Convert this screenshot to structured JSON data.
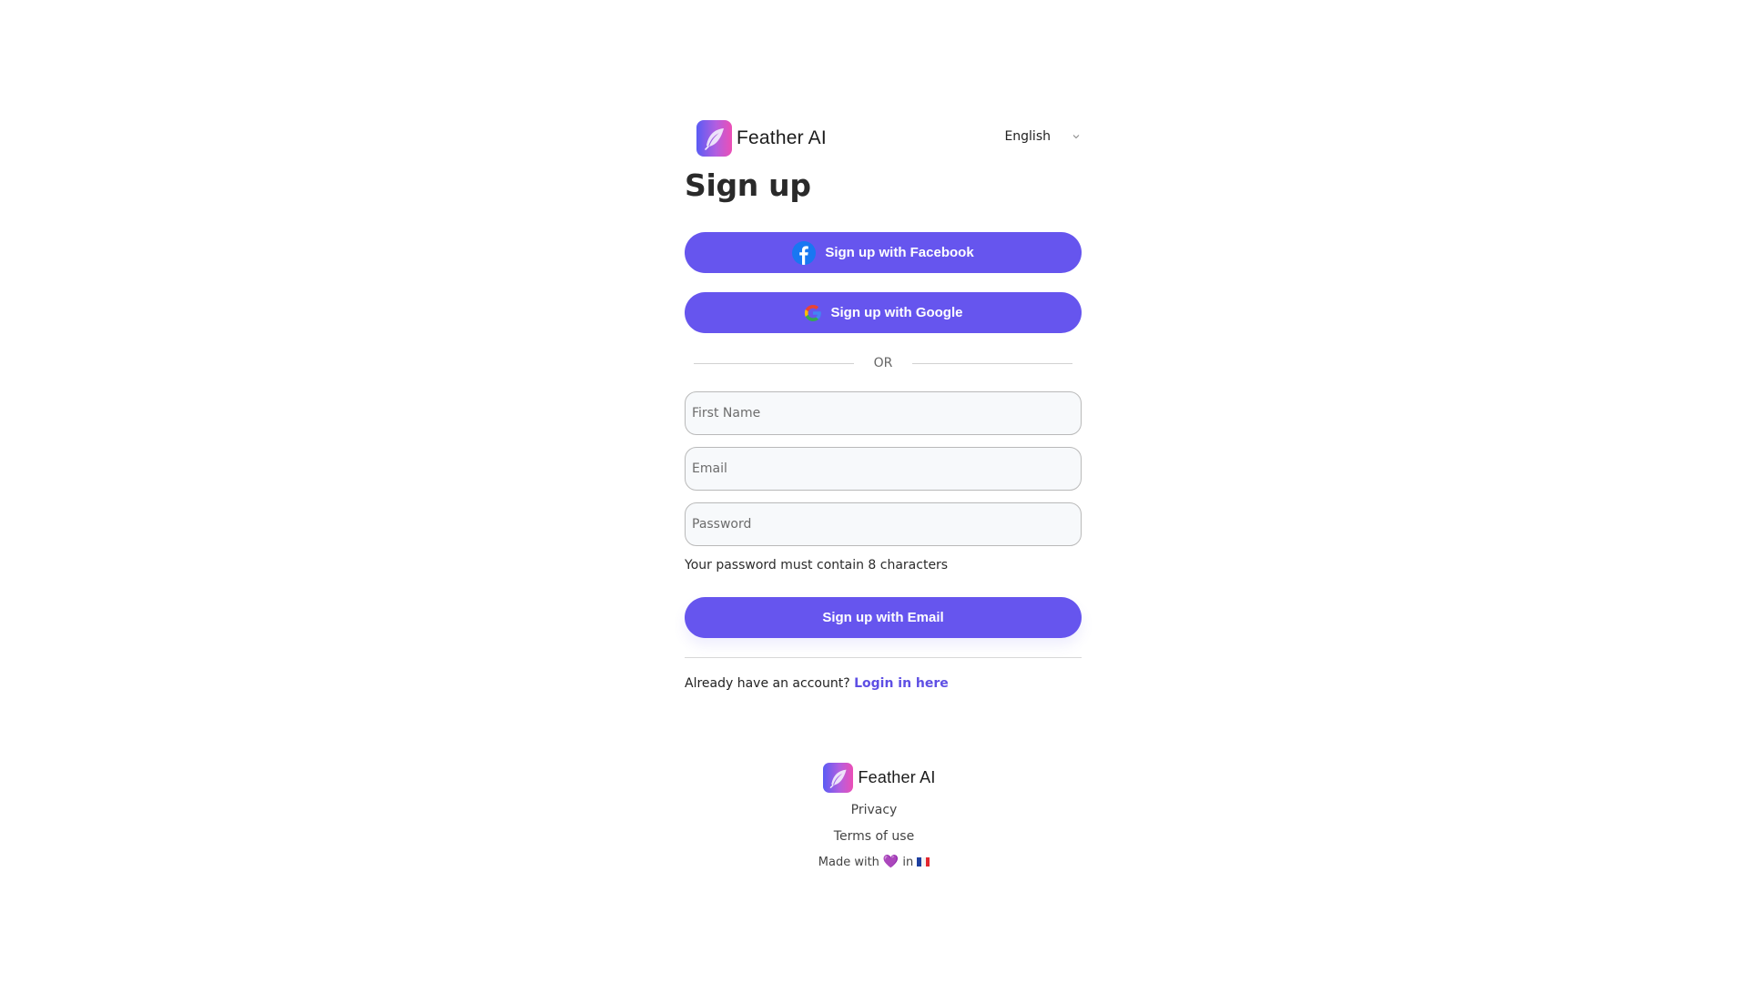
{
  "brand": {
    "name": "Feather AI"
  },
  "language": {
    "selected": "English"
  },
  "page": {
    "title": "Sign up"
  },
  "social": {
    "facebook_label": "Sign up with Facebook",
    "google_label": "Sign up with Google"
  },
  "divider": {
    "or_label": "OR"
  },
  "form": {
    "first_name_placeholder": "First Name",
    "email_placeholder": "Email",
    "password_placeholder": "Password",
    "password_hint": "Your password must contain 8 characters",
    "submit_label": "Sign up with Email"
  },
  "login": {
    "prompt": "Already have an account?",
    "link_label": "Login in here"
  },
  "footer": {
    "brand_name": "Feather AI",
    "privacy": "Privacy",
    "terms": "Terms of use",
    "made_with": "Made with",
    "made_in": "in",
    "heart": "💜"
  },
  "colors": {
    "accent": "#6655ee",
    "link": "#5e4fe4",
    "facebook": "#1877f2"
  }
}
